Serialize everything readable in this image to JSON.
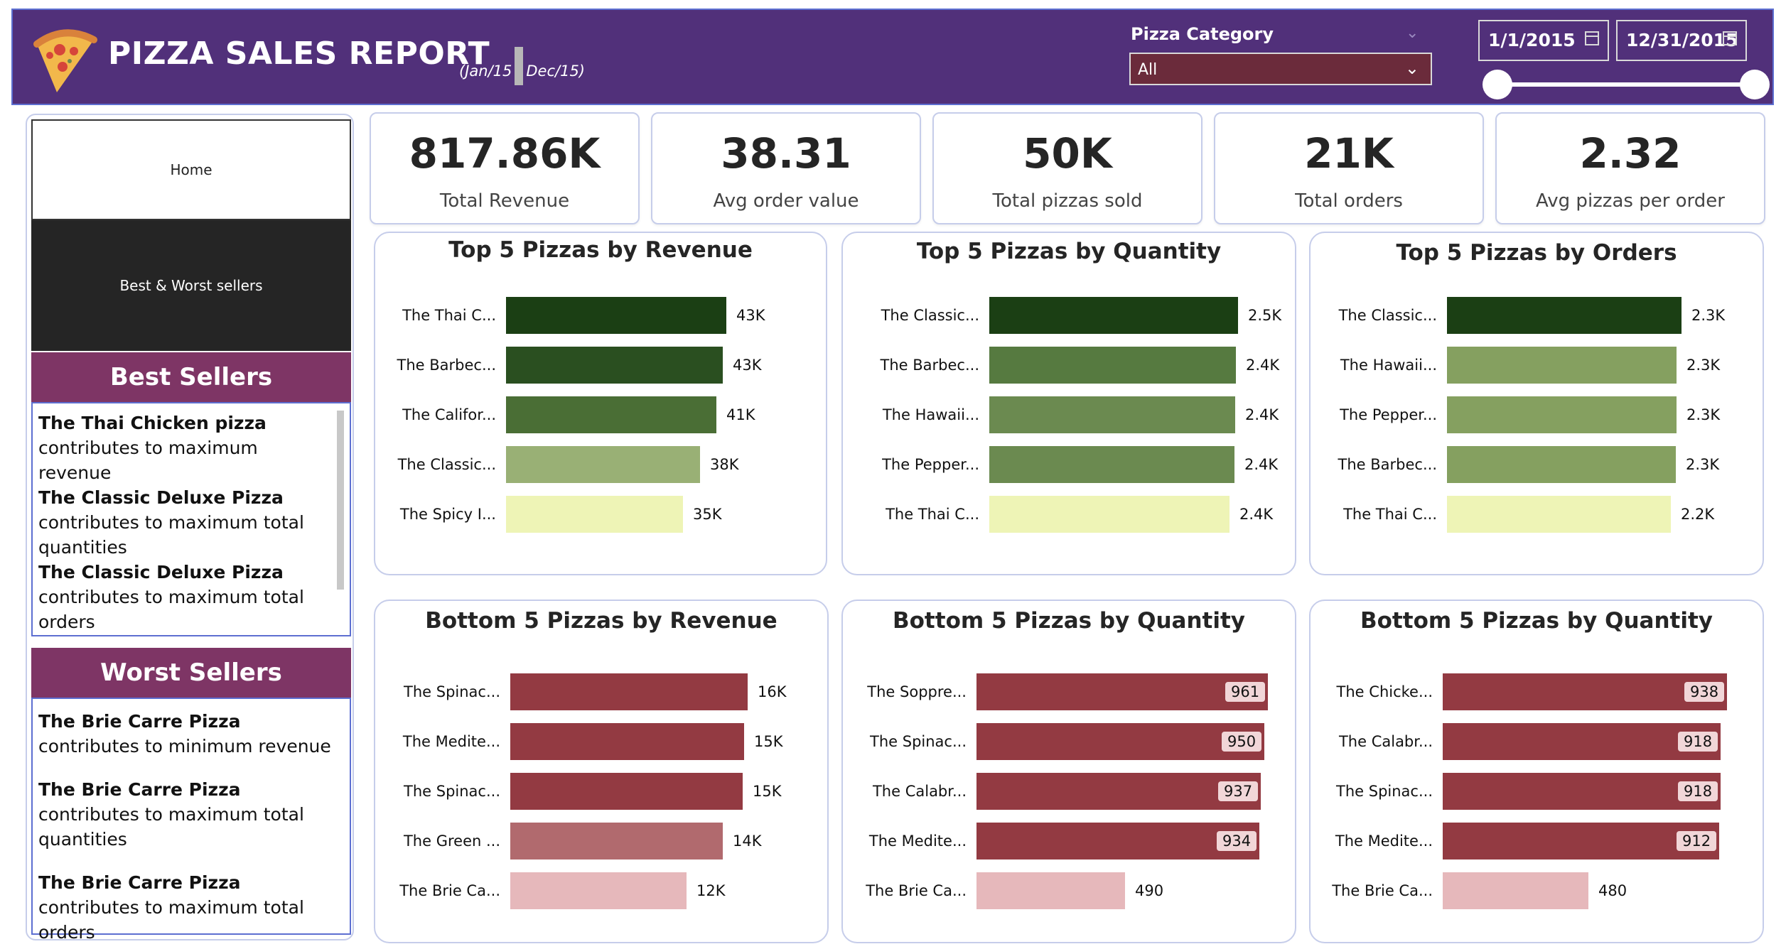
{
  "header": {
    "title": "PIZZA SALES REPORT",
    "subtitle_start": "(Jan/15",
    "subtitle_end": "Dec/15)",
    "category_label": "Pizza Category",
    "category_value": "All",
    "date_start": "1/1/2015",
    "date_end": "12/31/2015"
  },
  "nav": {
    "home": "Home",
    "best_worst": "Best & Worst sellers"
  },
  "best_sellers": {
    "title": "Best Sellers",
    "items": [
      {
        "bold": "The Thai Chicken pizza",
        "rest": " contributes to maximum revenue"
      },
      {
        "bold": "The Classic Deluxe Pizza",
        "rest": " contributes to maximum total quantities"
      },
      {
        "bold": "The Classic Deluxe Pizza",
        "rest": " contributes to maximum total orders"
      }
    ]
  },
  "worst_sellers": {
    "title": "Worst Sellers",
    "items": [
      {
        "bold": "The Brie Carre Pizza",
        "rest": " contributes to minimum revenue"
      },
      {
        "bold": "The Brie Carre Pizza",
        "rest": " contributes to maximum total quantities"
      },
      {
        "bold": "The Brie Carre Pizza",
        "rest": " contributes to maximum total orders"
      }
    ]
  },
  "kpis": [
    {
      "value": "817.86K",
      "label": "Total Revenue"
    },
    {
      "value": "38.31",
      "label": "Avg order value"
    },
    {
      "value": "50K",
      "label": "Total pizzas sold"
    },
    {
      "value": "21K",
      "label": "Total orders"
    },
    {
      "value": "2.32",
      "label": "Avg pizzas per order"
    }
  ],
  "colors": {
    "header_bg": "#51307a",
    "section_head": "#7e3565",
    "green_dark": "#1b3f14",
    "green_mid": "#6b8a50",
    "green_light": "#99b075",
    "green_pale": "#eef4b6",
    "red_dark": "#933a42",
    "red_mid": "#b16a6e",
    "red_pale": "#e6b8bb"
  },
  "chart_data": [
    {
      "type": "bar",
      "orientation": "horizontal",
      "title": "Top 5 Pizzas by Revenue",
      "categories": [
        "The Thai C...",
        "The Barbec...",
        "The Califor...",
        "The Classic...",
        "The Spicy I..."
      ],
      "values": [
        43434,
        42768,
        41410,
        38180,
        34831
      ],
      "labels": [
        "43K",
        "43K",
        "41K",
        "38K",
        "35K"
      ],
      "colors": [
        "#1b3f14",
        "#2a4f20",
        "#4a6e35",
        "#99b075",
        "#eef4b6"
      ]
    },
    {
      "type": "bar",
      "orientation": "horizontal",
      "title": "Top 5 Pizzas by Quantity",
      "categories": [
        "The Classic...",
        "The Barbec...",
        "The Hawaii...",
        "The Pepper...",
        "The Thai C..."
      ],
      "values": [
        2453,
        2432,
        2422,
        2418,
        2371
      ],
      "labels": [
        "2.5K",
        "2.4K",
        "2.4K",
        "2.4K",
        "2.4K"
      ],
      "colors": [
        "#1b3f14",
        "#567a40",
        "#6b8a50",
        "#6b8a50",
        "#eef4b6"
      ]
    },
    {
      "type": "bar",
      "orientation": "horizontal",
      "title": "Top 5 Pizzas by Orders",
      "categories": [
        "The Classic...",
        "The Hawaii...",
        "The Pepper...",
        "The Barbec...",
        "The Thai C..."
      ],
      "values": [
        2329,
        2280,
        2278,
        2273,
        2225
      ],
      "labels": [
        "2.3K",
        "2.3K",
        "2.3K",
        "2.3K",
        "2.2K"
      ],
      "colors": [
        "#1b3f14",
        "#85a060",
        "#85a060",
        "#85a060",
        "#eef4b6"
      ]
    },
    {
      "type": "bar",
      "orientation": "horizontal",
      "title": "Bottom 5 Pizzas by Revenue",
      "categories": [
        "The Spinac...",
        "The Medite...",
        "The Spinac...",
        "The Green ...",
        "The Brie Ca..."
      ],
      "values": [
        15596,
        15360,
        15277,
        13956,
        11589
      ],
      "labels": [
        "16K",
        "15K",
        "15K",
        "14K",
        "12K"
      ],
      "colors": [
        "#933a42",
        "#933a42",
        "#933a42",
        "#b16a6e",
        "#e6b8bb"
      ]
    },
    {
      "type": "bar",
      "orientation": "horizontal",
      "title": "Bottom 5 Pizzas by Quantity",
      "categories": [
        "The Soppre...",
        "The Spinac...",
        "The Calabr...",
        "The Medite...",
        "The Brie Ca..."
      ],
      "values": [
        961,
        950,
        937,
        934,
        490
      ],
      "labels": [
        "961",
        "950",
        "937",
        "934",
        "490"
      ],
      "colors": [
        "#933a42",
        "#933a42",
        "#933a42",
        "#933a42",
        "#e6b8bb"
      ]
    },
    {
      "type": "bar",
      "orientation": "horizontal",
      "title": "Bottom 5 Pizzas by Quantity",
      "categories": [
        "The Chicke...",
        "The Calabr...",
        "The Spinac...",
        "The Medite...",
        "The Brie Ca..."
      ],
      "values": [
        938,
        918,
        918,
        912,
        480
      ],
      "labels": [
        "938",
        "918",
        "918",
        "912",
        "480"
      ],
      "colors": [
        "#933a42",
        "#933a42",
        "#933a42",
        "#933a42",
        "#e6b8bb"
      ]
    }
  ]
}
